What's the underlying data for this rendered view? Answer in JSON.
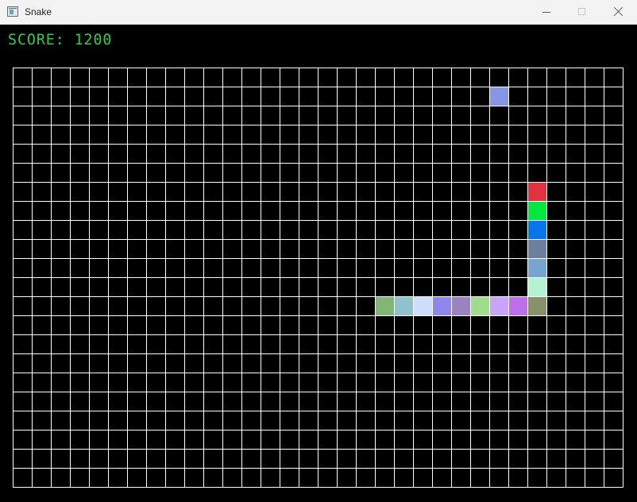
{
  "window": {
    "title": "Snake",
    "icon": "app-window-icon",
    "controls": [
      {
        "name": "minimize",
        "icon": "minimize-icon"
      },
      {
        "name": "maximize",
        "icon": "maximize-icon"
      },
      {
        "name": "close",
        "icon": "close-icon"
      }
    ]
  },
  "game": {
    "score_label": "SCORE: 1200",
    "grid": {
      "columns": 32,
      "rows": 22,
      "line_color": "#ffffff",
      "background_color": "#000000"
    },
    "food": {
      "column": 25,
      "row": 1,
      "color": "#8796e4"
    },
    "snake": {
      "segments": [
        {
          "column": 27,
          "row": 6,
          "color": "#e2313f"
        },
        {
          "column": 27,
          "row": 7,
          "color": "#05e640"
        },
        {
          "column": 27,
          "row": 8,
          "color": "#0677ea"
        },
        {
          "column": 27,
          "row": 9,
          "color": "#6d7f9d"
        },
        {
          "column": 27,
          "row": 10,
          "color": "#77a5d0"
        },
        {
          "column": 27,
          "row": 11,
          "color": "#b4f2d4"
        },
        {
          "column": 27,
          "row": 12,
          "color": "#87916b"
        },
        {
          "column": 26,
          "row": 12,
          "color": "#bd6fe7"
        },
        {
          "column": 25,
          "row": 12,
          "color": "#c7a6f7"
        },
        {
          "column": 24,
          "row": 12,
          "color": "#9fdc8c"
        },
        {
          "column": 23,
          "row": 12,
          "color": "#9b82c0"
        },
        {
          "column": 22,
          "row": 12,
          "color": "#8e85ed"
        },
        {
          "column": 21,
          "row": 12,
          "color": "#cdddfb"
        },
        {
          "column": 20,
          "row": 12,
          "color": "#90c2ce"
        },
        {
          "column": 19,
          "row": 12,
          "color": "#82b677"
        }
      ]
    }
  }
}
